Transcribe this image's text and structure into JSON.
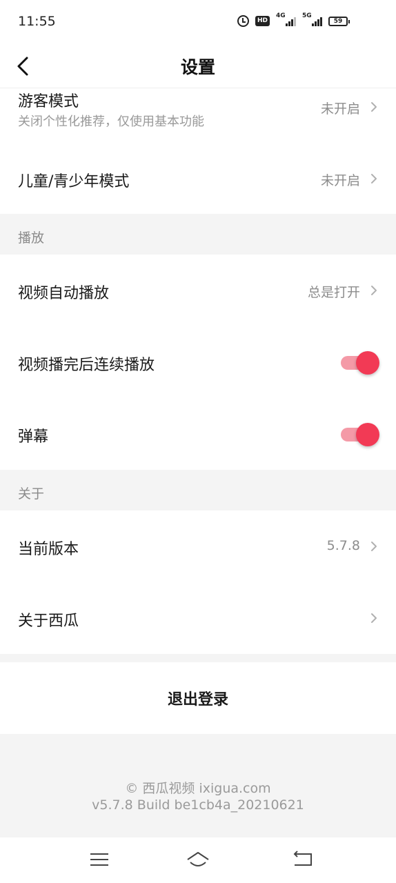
{
  "status_bar": {
    "time": "11:55",
    "icons": [
      "alarm-icon",
      "hd-icon",
      "signal-4g-icon",
      "signal-5g-icon",
      "battery-icon"
    ],
    "hd_label": "HD",
    "net1_label": "4G",
    "net2_label": "5G",
    "battery_level": "59"
  },
  "header": {
    "title": "设置",
    "back_icon": "chevron-left-icon"
  },
  "general": {
    "guest_mode": {
      "label": "游客模式",
      "sub": "关闭个性化推荐，仅使用基本功能",
      "value": "未开启"
    },
    "kids_mode": {
      "label": "儿童/青少年模式",
      "value": "未开启"
    }
  },
  "playback": {
    "section_label": "播放",
    "autoplay": {
      "label": "视频自动播放",
      "value": "总是打开"
    },
    "continuous": {
      "label": "视频播完后连续播放",
      "enabled": true
    },
    "danmaku": {
      "label": "弹幕",
      "enabled": true
    }
  },
  "about": {
    "section_label": "关于",
    "version": {
      "label": "当前版本",
      "value": "5.7.8"
    },
    "about_app": {
      "label": "关于西瓜"
    }
  },
  "logout": {
    "label": "退出登录"
  },
  "footer": {
    "copyright": "© 西瓜视频 ixigua.com",
    "build": "v5.7.8 Build be1cb4a_20210621"
  },
  "nav": {
    "icons": [
      "menu-icon",
      "home-icon",
      "back-icon"
    ]
  },
  "colors": {
    "accent": "#f23a55",
    "toggle_track": "#f49aa7",
    "section_bg": "#f4f4f4",
    "secondary_text": "#8c8c8c"
  }
}
